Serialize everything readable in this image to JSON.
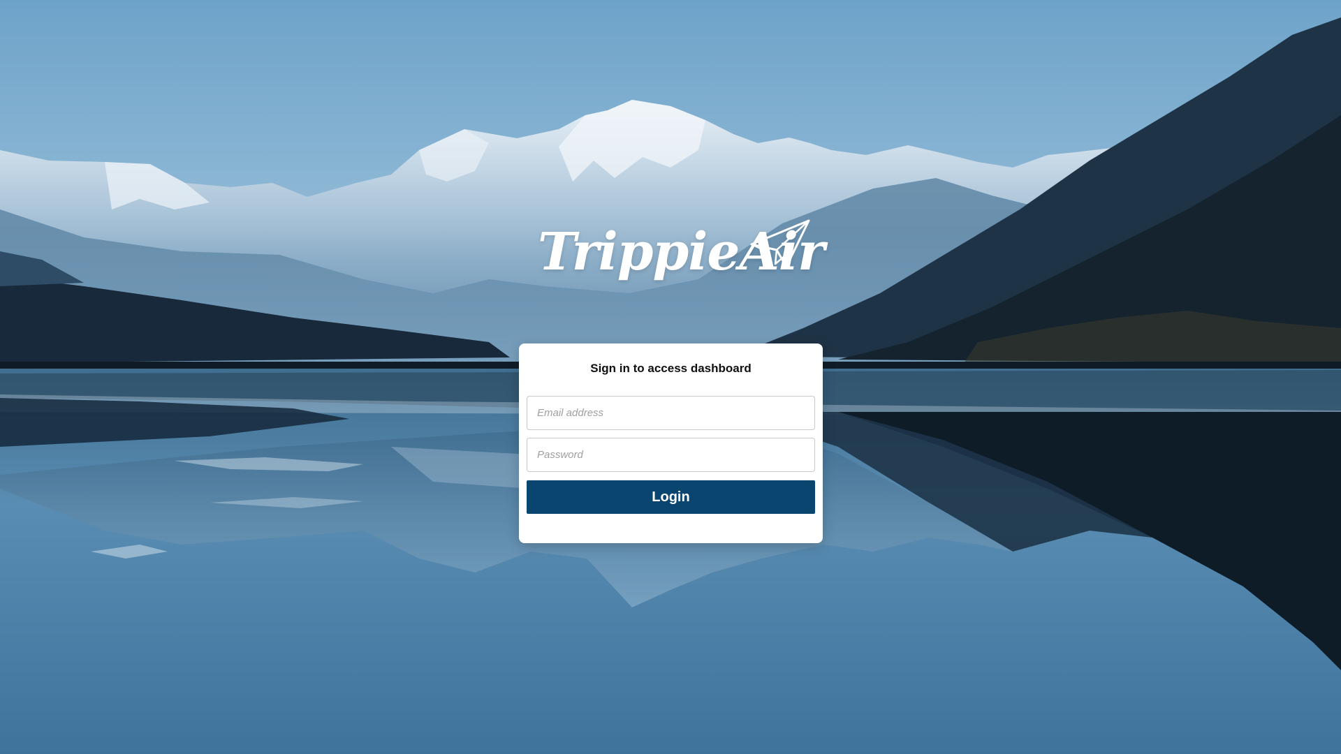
{
  "brand": {
    "name": "TrippieAir",
    "logo_icon": "paper-plane-icon"
  },
  "login": {
    "heading": "Sign in to access dashboard",
    "email_placeholder": "Email address",
    "email_value": "",
    "password_placeholder": "Password",
    "password_value": "",
    "submit_label": "Login"
  },
  "colors": {
    "primary_button": "#0a4570",
    "card_background": "#ffffff",
    "sky": "#6ea3c9"
  }
}
